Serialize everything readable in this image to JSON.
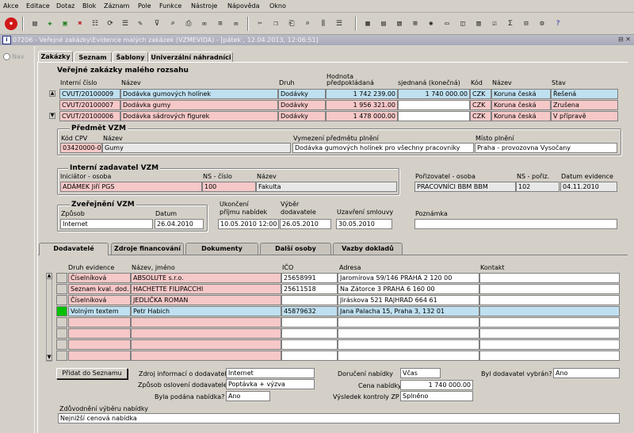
{
  "menu": [
    "Akce",
    "Editace",
    "Dotaz",
    "Blok",
    "Záznam",
    "Pole",
    "Funkce",
    "Nástroje",
    "Nápověda",
    "Okno"
  ],
  "window": {
    "title": "07206 - Veřejné zakázky\\Evidence malých zakázek (VZMEVIDA) - [pátek , 12.04.2013, 12:06:51]",
    "controls": "⊟ ✕",
    "app_icon": "i"
  },
  "nav": {
    "label": "Nav"
  },
  "top_tabs": [
    "Zakázky",
    "Seznam",
    "Šablony",
    "Univerzální náhradníci"
  ],
  "zakazky": {
    "title": "Veřejné zakázky malého rozsahu",
    "headers": {
      "interni_cislo": "Interní číslo",
      "nazev": "Název",
      "druh": "Druh",
      "hodnota": "Hodnota",
      "predpokladana": "předpokládaná",
      "sjednana": "sjednaná (konečná)",
      "kod": "Kód",
      "nazev_meny": "Název",
      "stav": "Stav"
    },
    "rows": [
      {
        "cislo": "CVUT/20100009",
        "nazev": "Dodávka gumových holínek",
        "druh": "Dodávky",
        "predp": "1 742 239.00",
        "sjedn": "1 740 000.00",
        "kod": "CZK",
        "mena": "Koruna česká",
        "stav": "Řešená"
      },
      {
        "cislo": "CVUT/20100007",
        "nazev": "Dodávka gumy",
        "druh": "Dodávky",
        "predp": "1 956 321.00",
        "sjedn": "",
        "kod": "CZK",
        "mena": "Koruna česká",
        "stav": "Zrušena"
      },
      {
        "cislo": "CVUT/20100006",
        "nazev": "Dodávka sádrových figurek",
        "druh": "Dodávky",
        "predp": "1 478 000.00",
        "sjedn": "",
        "kod": "CZK",
        "mena": "Koruna česká",
        "stav": "V přípravě"
      }
    ]
  },
  "predmet": {
    "title": "Předmět VZM",
    "labels": {
      "kod": "Kód CPV",
      "nazev": "Název",
      "vymezeni": "Vymezení předmětu plnění",
      "misto": "Místo plnění"
    },
    "kod": "03420000-0",
    "nazev": "Gumy",
    "vymezeni": "Dodávka gumových holínek pro všechny pracovníky",
    "misto": "Praha - provozovna Vysočany"
  },
  "interni": {
    "title": "Interní zadavatel VZM",
    "labels": {
      "iniciator": "Iniciátor - osoba",
      "ns": "NS - číslo",
      "nazev": "Název"
    },
    "iniciator": "ADÁMEK Jiří PGS",
    "ns": "100",
    "nazev": "Fakulta"
  },
  "porizovatel": {
    "labels": {
      "osoba": "Pořizovatel - osoba",
      "ns": "NS - pořiz.",
      "datum": "Datum evidence"
    },
    "osoba": "PRACOVNÍCI BBM BBM",
    "ns": "102",
    "datum": "04.11.2010"
  },
  "zverejneni": {
    "title": "Zveřejnění VZM",
    "labels": {
      "zpusob": "Způsob",
      "datum": "Datum"
    },
    "zpusob": "Internet",
    "datum": "26.04.2010"
  },
  "terminy": {
    "labels": {
      "ukonceni1": "Ukončení",
      "ukonceni2": "příjmu nabídek",
      "vyber1": "Výběr",
      "vyber2": "dodavatele",
      "uzavreni": "Uzavření smlouvy",
      "poznamka": "Poznámka"
    },
    "ukonceni": "10.05.2010 12:00",
    "vyber": "26.05.2010",
    "uzavreni": "30.05.2010",
    "poznamka": ""
  },
  "bottom_tabs": [
    "Dodavatelé",
    "Zdroje financování",
    "Dokumenty",
    "Další osoby",
    "Vazby dokladů"
  ],
  "dodavatele": {
    "headers": {
      "druh": "Druh evidence",
      "nazev": "Název, jméno",
      "ico": "IČO",
      "adresa": "Adresa",
      "kontakt": "Kontakt"
    },
    "rows": [
      {
        "druh": "Číselníková",
        "nazev": "ABSOLUTE s.r.o.",
        "ico": "25658991",
        "adresa": "Jaromírova 59/146 PRAHA 2 120 00",
        "kontakt": ""
      },
      {
        "druh": "Seznam kval. dod.",
        "nazev": "HACHETTE FILIPACCHI",
        "ico": "25611518",
        "adresa": "Na Zátorce 3 PRAHA 6 160 00",
        "kontakt": ""
      },
      {
        "druh": "Číselníková",
        "nazev": "JEDLIČKA ROMAN",
        "ico": "",
        "adresa": "Jiráskova 521 RAJHRAD 664 61",
        "kontakt": ""
      },
      {
        "druh": "Volným textem",
        "nazev": "Petr Habich",
        "ico": "45879632",
        "adresa": "Jana Palacha 15, Praha 3, 132 01",
        "kontakt": ""
      }
    ]
  },
  "detail": {
    "pridat": "Přidat do Seznamu",
    "labels": {
      "zdroj": "Zdroj informací o dodavateli",
      "zpusob": "Způsob oslovení dodavatele",
      "podana": "Byla podána nabídka?",
      "doruceni": "Doručení nabídky",
      "cena": "Cena nabídky",
      "vysledek": "Výsledek kontroly ZP",
      "vybran": "Byl dodavatel vybrán?",
      "zduvodneni": "Zdůvodnění výběru nabídky"
    },
    "zdroj": "Internet",
    "zpusob": "Poptávka + výzva",
    "podana": "Ano",
    "doruceni": "Včas",
    "cena": "1 740 000.00",
    "vysledek": "Splněno",
    "vybran": "Ano",
    "zduvodneni": "Nejnižší cenová nabídka"
  }
}
